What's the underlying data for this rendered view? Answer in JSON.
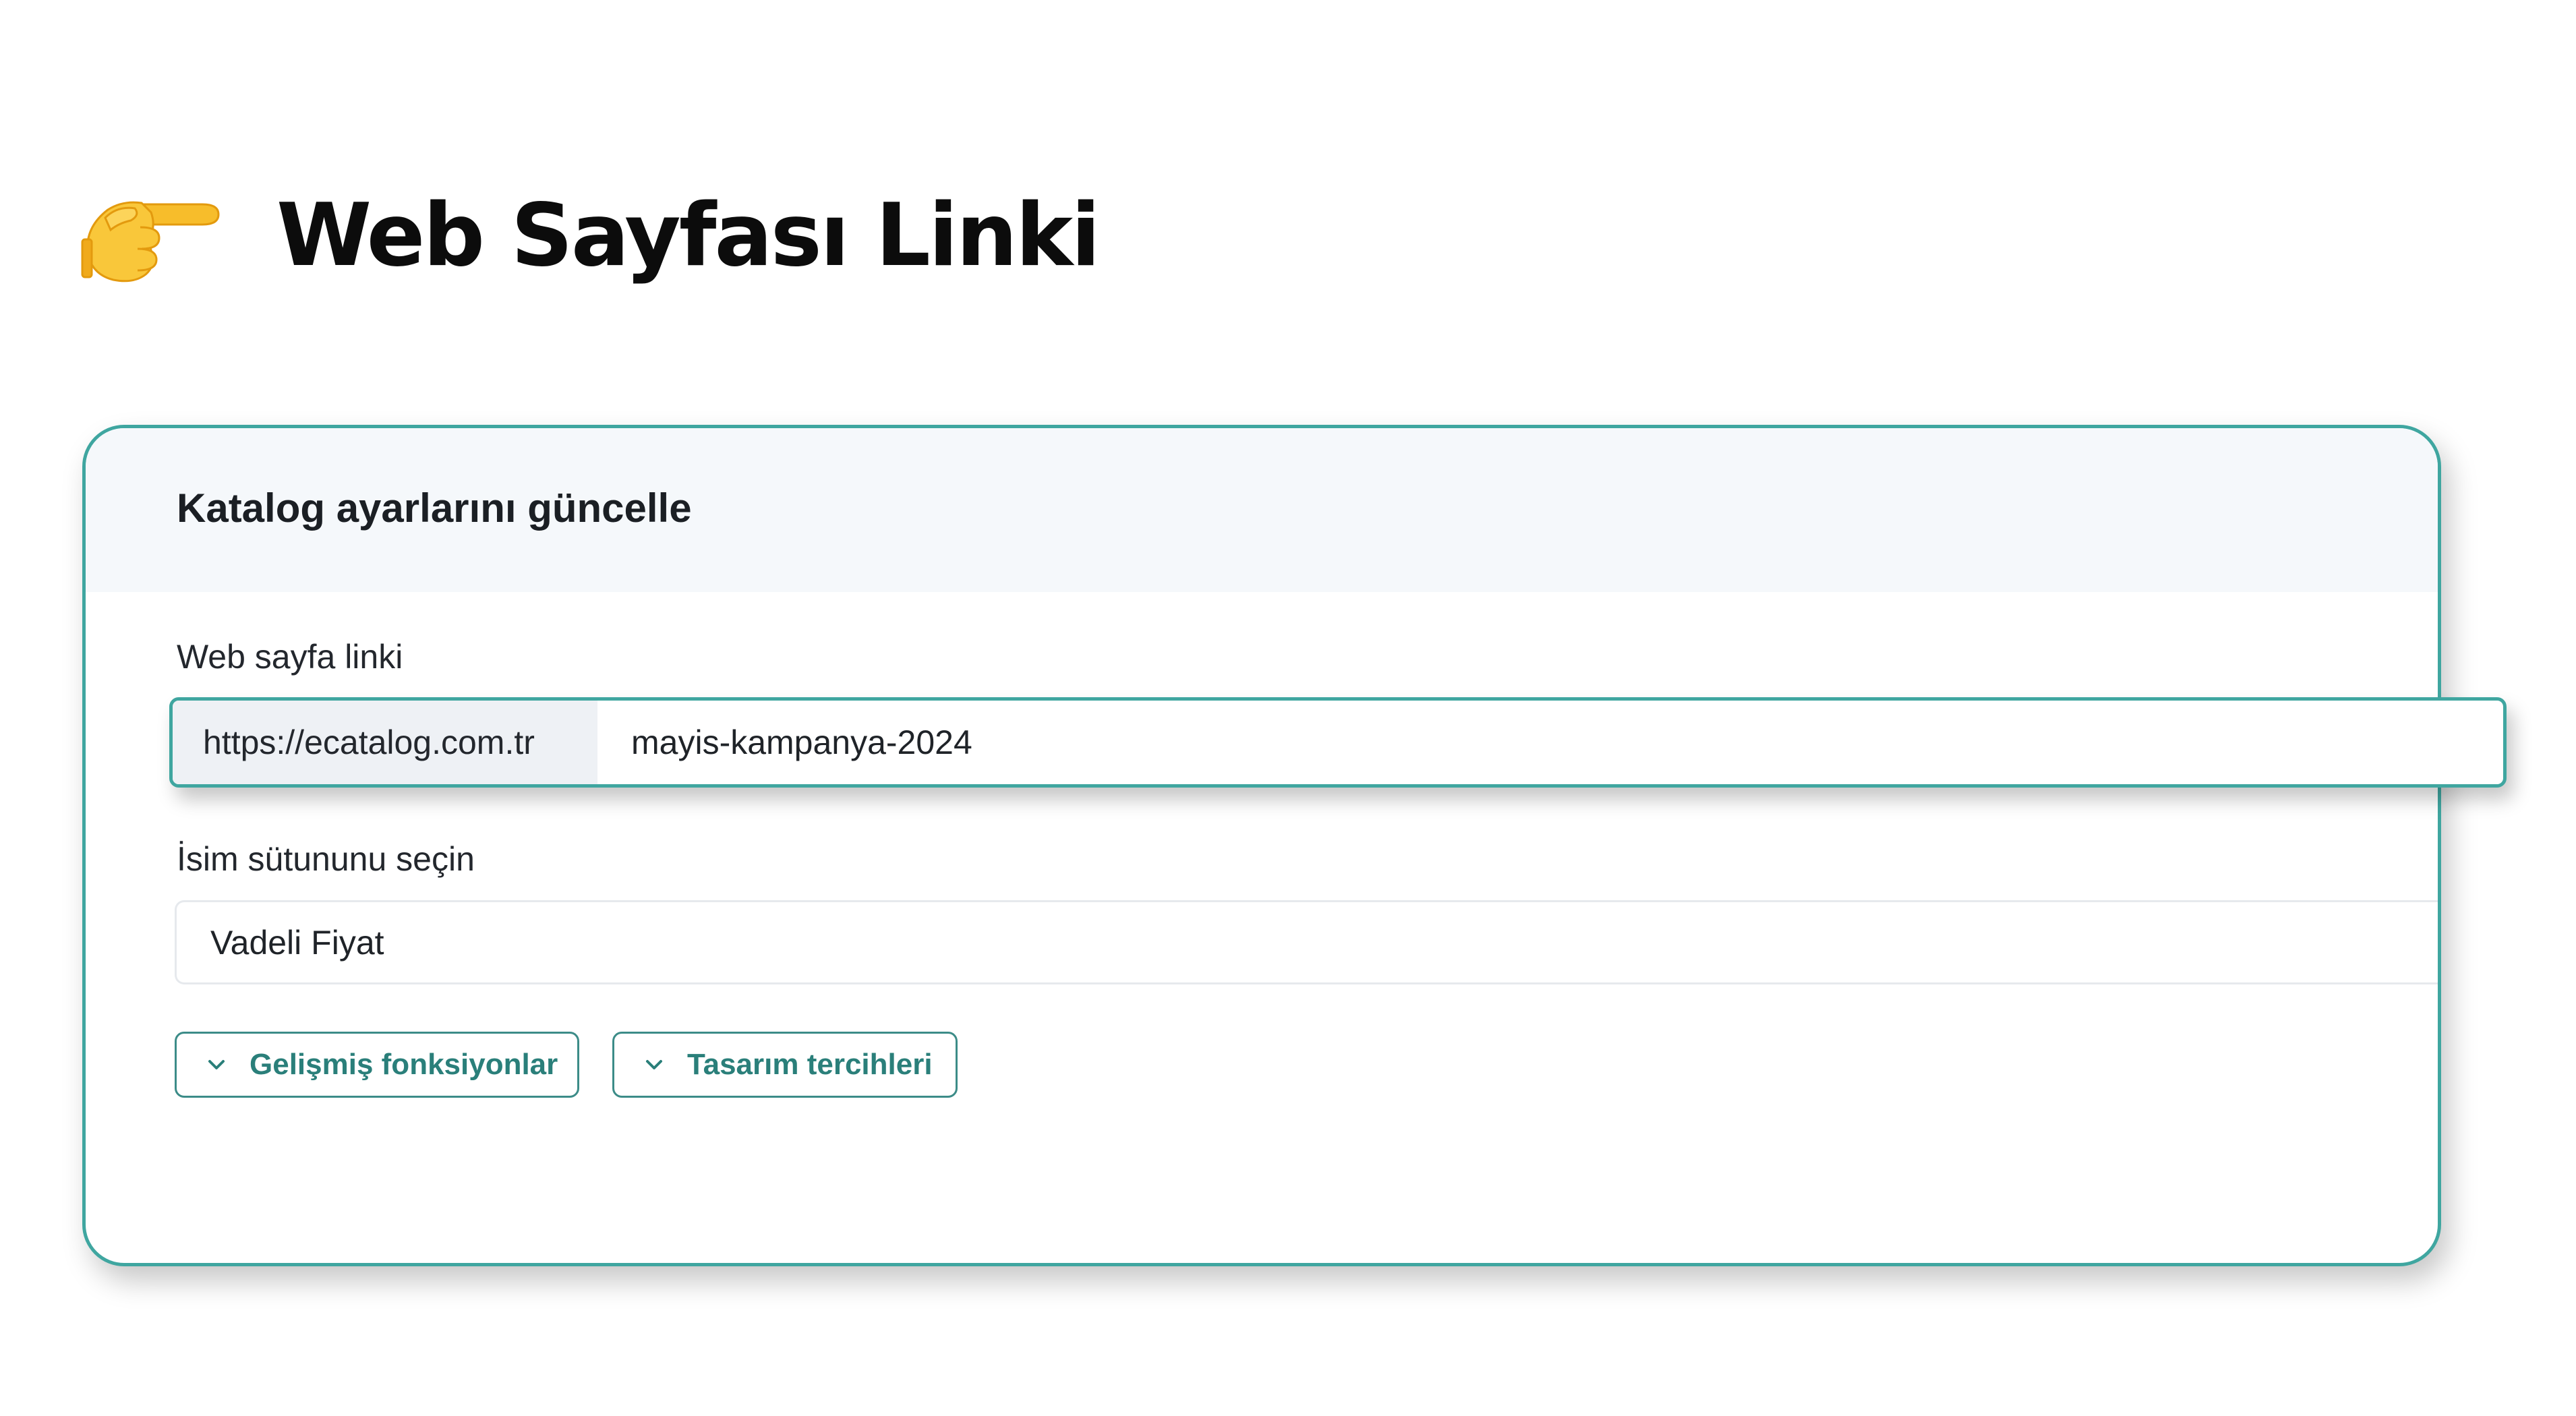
{
  "page": {
    "title": "Web Sayfası Linki",
    "title_icon": "backhand-index-pointing-right-icon"
  },
  "card": {
    "title": "Katalog ayarlarını güncelle",
    "border_color": "#3fa6a0",
    "web_link": {
      "label": "Web sayfa linki",
      "prefix": "https://ecatalog.com.tr",
      "value": "mayis-kampanya-2024"
    },
    "name_column": {
      "label": "İsim sütununu seçin",
      "selected": "Vadeli Fiyat"
    },
    "buttons": {
      "advanced_label": "Gelişmiş fonksiyonlar",
      "design_label": "Tasarım tercihleri",
      "icon": "chevron-down-icon",
      "color": "#2a7f7a"
    }
  }
}
